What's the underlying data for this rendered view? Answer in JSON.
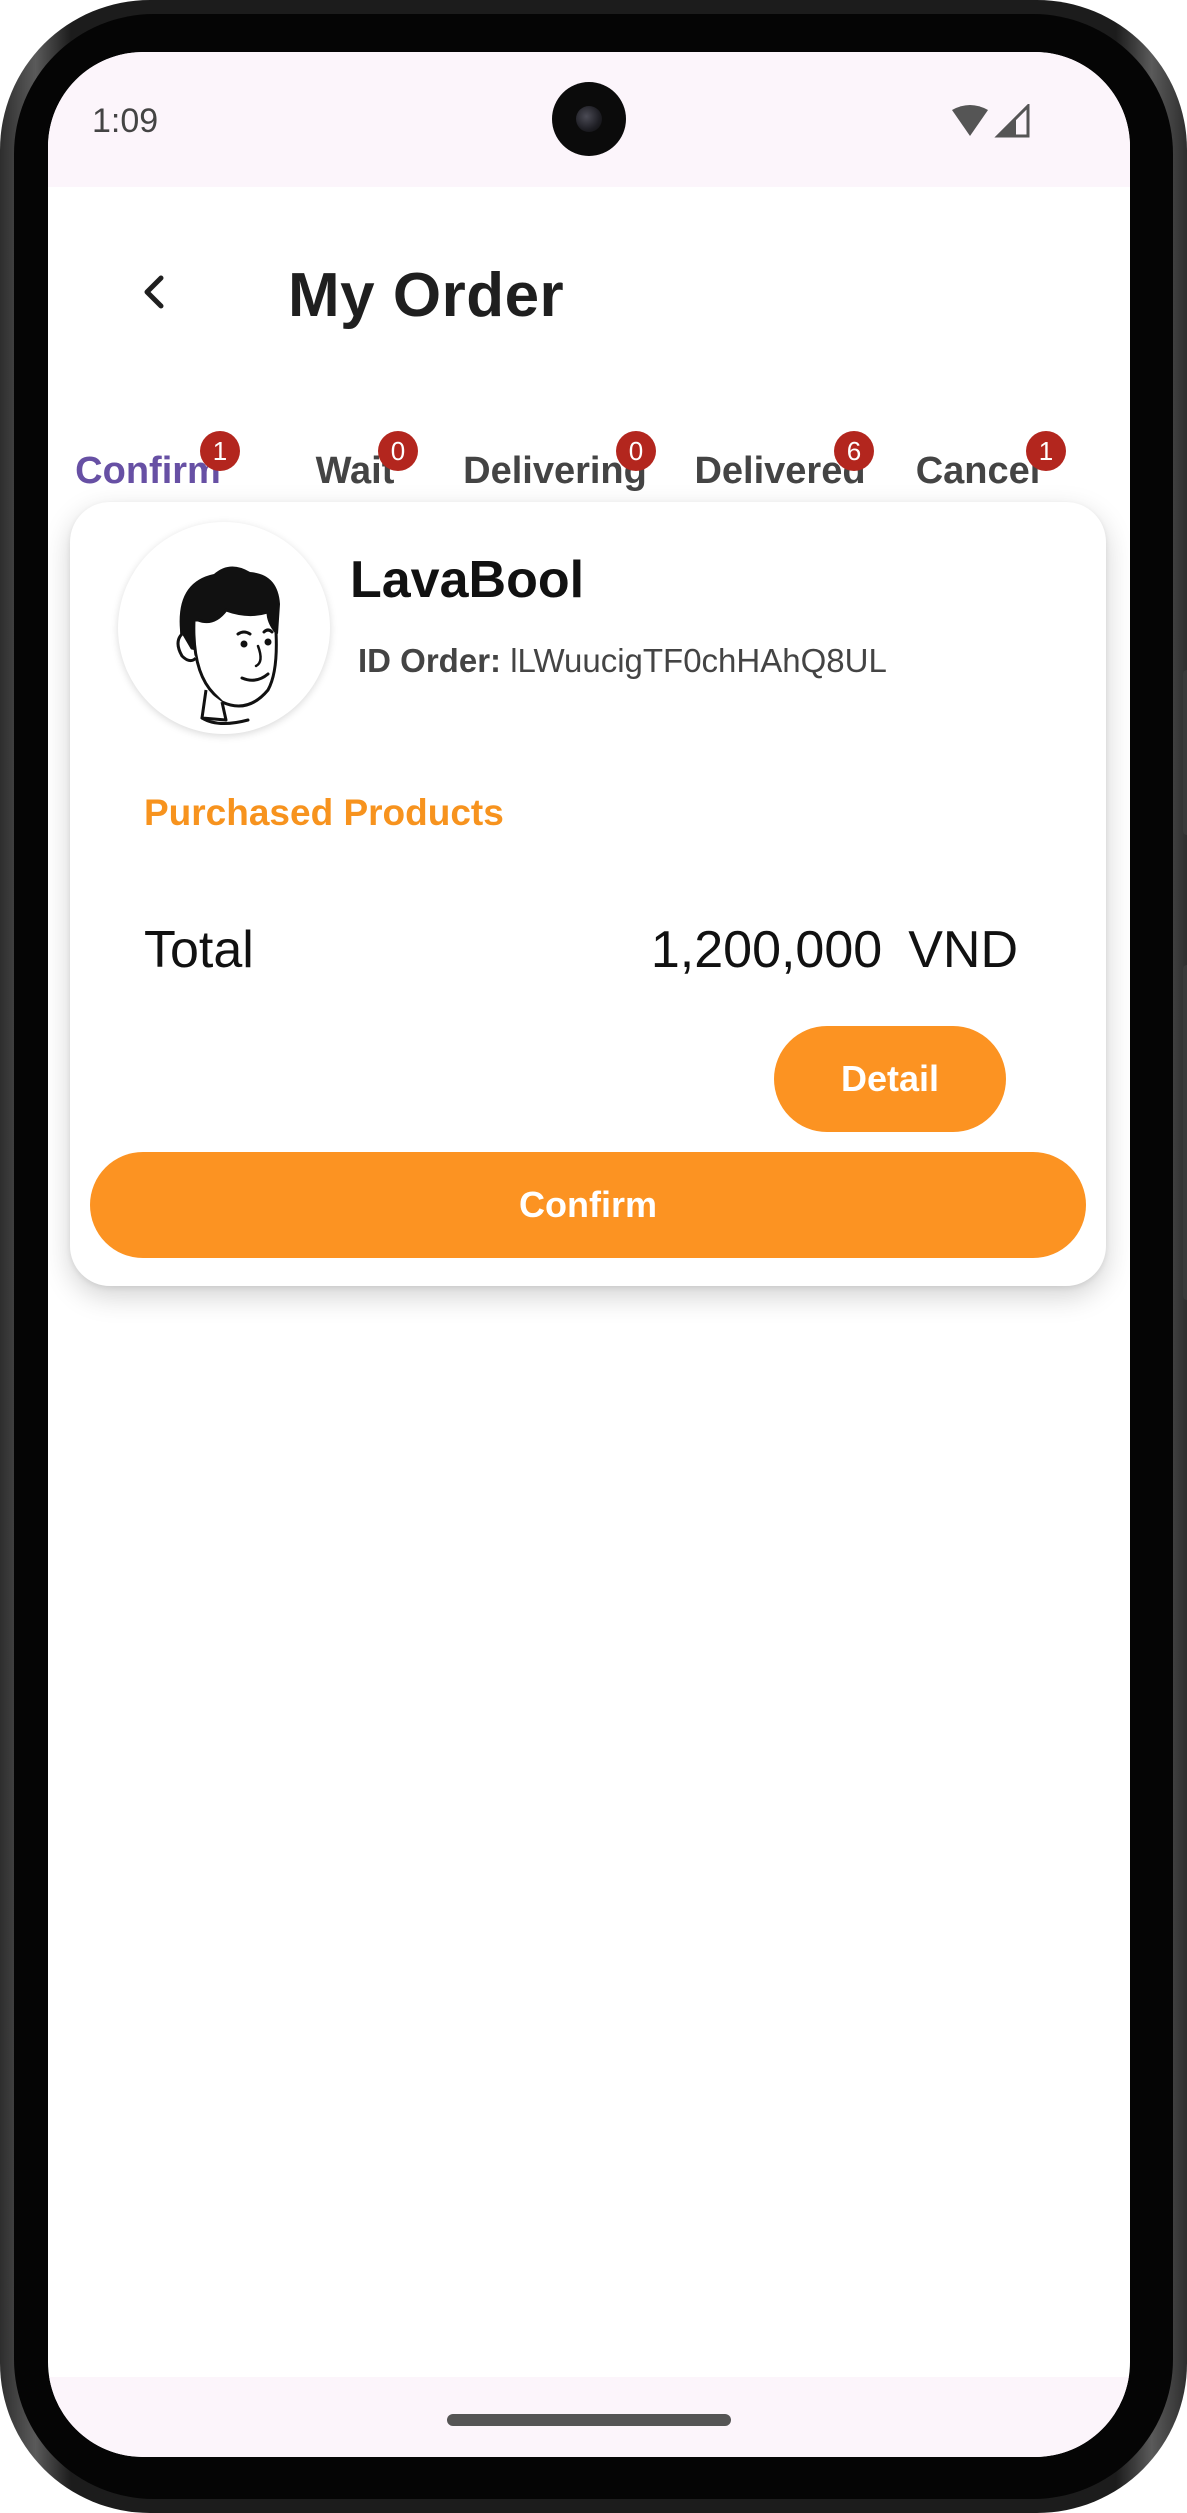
{
  "status_bar": {
    "time": "1:09",
    "icons": [
      "wifi-icon",
      "signal-icon"
    ]
  },
  "header": {
    "title": "My Order",
    "back_icon": "chevron-left-icon"
  },
  "tabs": [
    {
      "label": "Confirm",
      "badge": "1",
      "active": true
    },
    {
      "label": "Wait",
      "badge": "0",
      "active": false
    },
    {
      "label": "Delivering",
      "badge": "0",
      "active": false
    },
    {
      "label": "Delivered",
      "badge": "6",
      "active": false
    },
    {
      "label": "Cancel",
      "badge": "1",
      "active": false
    }
  ],
  "order": {
    "customer_name": "LavaBool",
    "id_label": "ID Order:",
    "id_value": "lLWuucigTF0chHAhQ8UL",
    "section_title": "Purchased Products",
    "total_label": "Total",
    "total_amount": "1,200,000",
    "currency": "VND",
    "detail_label": "Detail",
    "confirm_label": "Confirm"
  },
  "colors": {
    "accent_orange": "#fc9322",
    "section_orange": "#f7931e",
    "tab_active": "#6750a4",
    "badge_red": "#b3261e"
  }
}
